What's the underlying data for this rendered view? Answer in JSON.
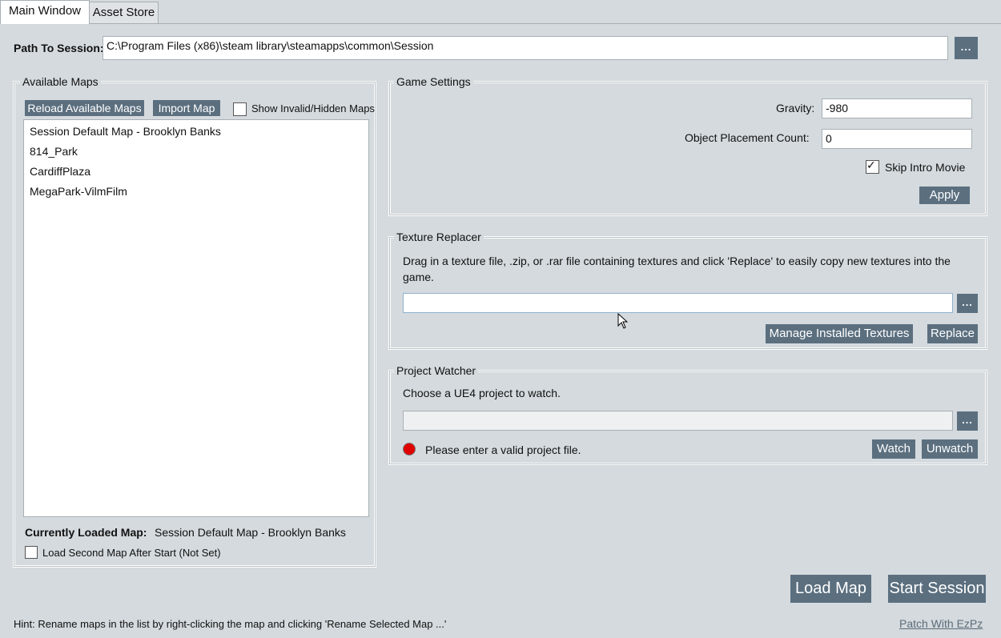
{
  "tabs": [
    {
      "label": "Main Window",
      "active": true
    },
    {
      "label": "Asset Store",
      "active": false
    }
  ],
  "path": {
    "label": "Path To Session:",
    "value": "C:\\Program Files (x86)\\steam library\\steamapps\\common\\Session",
    "browse_label": "..."
  },
  "maps": {
    "legend": "Available Maps",
    "reload_label": "Reload Available Maps",
    "import_label": "Import Map",
    "show_invalid_label": "Show Invalid/Hidden Maps",
    "show_invalid_checked": false,
    "items": [
      "Session Default Map - Brooklyn Banks",
      "814_Park",
      "CardiffPlaza",
      "MegaPark-VilmFilm"
    ],
    "current_label": "Currently Loaded Map:",
    "current_value": "Session Default Map - Brooklyn Banks",
    "second_map_label": "Load Second Map After Start (Not Set)",
    "second_map_checked": false
  },
  "game_settings": {
    "legend": "Game Settings",
    "gravity_label": "Gravity:",
    "gravity_value": "-980",
    "placement_label": "Object Placement Count:",
    "placement_value": "0",
    "skip_intro_label": "Skip Intro Movie",
    "skip_intro_checked": true,
    "apply_label": "Apply"
  },
  "texture": {
    "legend": "Texture Replacer",
    "description": "Drag in a texture file, .zip, or .rar file containing textures and click 'Replace' to easily copy new textures into the game.",
    "value": "",
    "browse_label": "...",
    "manage_label": "Manage Installed Textures",
    "replace_label": "Replace"
  },
  "watcher": {
    "legend": "Project Watcher",
    "description": "Choose a UE4 project to watch.",
    "value": "",
    "browse_label": "...",
    "status_text": "Please enter a valid project file.",
    "status_color": "#e00000",
    "watch_label": "Watch",
    "unwatch_label": "Unwatch"
  },
  "actions": {
    "load_map_label": "Load Map",
    "start_session_label": "Start Session"
  },
  "footer": {
    "hint": "Hint: Rename maps in the list by right-clicking the map and clicking 'Rename Selected Map ...'",
    "patch_link": "Patch With EzPz"
  },
  "colors": {
    "background": "#d4dade",
    "button": "#5b6f7f",
    "button_text": "#ffffff",
    "link": "#5d6c78"
  }
}
